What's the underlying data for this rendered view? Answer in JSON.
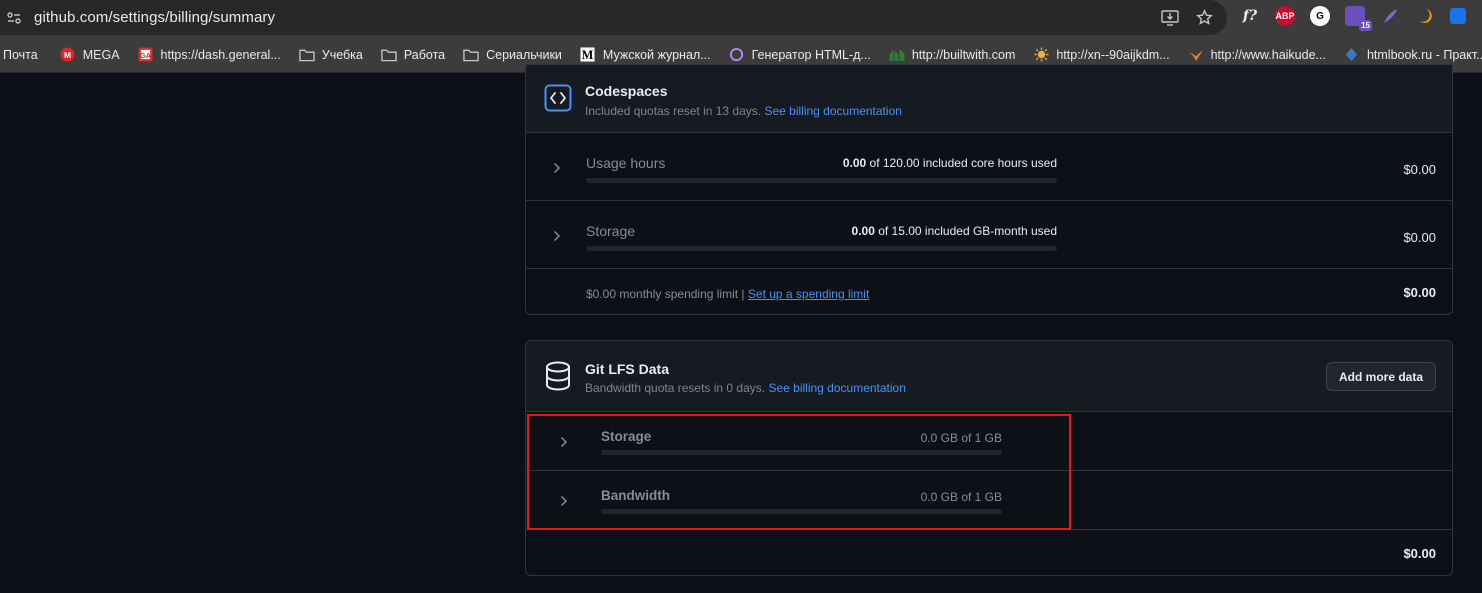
{
  "browser": {
    "url": "github.com/settings/billing/summary",
    "extensions": [
      {
        "name": "f?",
        "color": "#3c3c3c"
      },
      {
        "name": "ABP",
        "color": "#c70d2c"
      },
      {
        "name": "G",
        "color": "#ffffff"
      },
      {
        "name": "",
        "color": "#6b4fbb",
        "badge": "15"
      },
      {
        "name": "",
        "color": "#8a63d2"
      },
      {
        "name": "",
        "color": "#f29900"
      },
      {
        "name": "",
        "color": "#1a73e8"
      }
    ]
  },
  "bookmarks": [
    {
      "label": "Почта",
      "icon": "none"
    },
    {
      "label": "MEGA",
      "icon": "mega-icon"
    },
    {
      "label": "https://dash.general...",
      "icon": "ga-icon"
    },
    {
      "label": "Учебка",
      "icon": "folder-icon"
    },
    {
      "label": "Работа",
      "icon": "folder-icon"
    },
    {
      "label": "Сериальчики",
      "icon": "folder-icon"
    },
    {
      "label": "Мужской журнал...",
      "icon": "m-icon"
    },
    {
      "label": "Генератор HTML-д...",
      "icon": "circle-icon"
    },
    {
      "label": "http://builtwith.com",
      "icon": "builtwith-icon"
    },
    {
      "label": "http://xn--90aijkdm...",
      "icon": "sun-icon"
    },
    {
      "label": "http://www.haikude...",
      "icon": "bird-icon"
    },
    {
      "label": "htmlbook.ru - Практ...",
      "icon": "htmlbook-icon"
    }
  ],
  "codespaces": {
    "title": "Codespaces",
    "subtitle": "Included quotas reset in 13 days.",
    "doc_link": "See billing documentation",
    "rows": [
      {
        "label": "Usage hours",
        "used": "0.00",
        "of_text": "of 120.00 included core hours used",
        "progress": 0,
        "amount": "$0.00"
      },
      {
        "label": "Storage",
        "used": "0.00",
        "of_text": "of 15.00 included GB-month used",
        "progress": 0,
        "amount": "$0.00"
      }
    ],
    "limit_text": "$0.00 monthly spending limit |",
    "limit_link": "Set up a spending limit",
    "total": "$0.00"
  },
  "git_lfs": {
    "title": "Git LFS Data",
    "subtitle": "Bandwidth quota resets in 0 days.",
    "doc_link": "See billing documentation",
    "add_button": "Add more data",
    "rows": [
      {
        "label": "Storage",
        "usage": "0.0 GB of 1 GB",
        "progress": 0
      },
      {
        "label": "Bandwidth",
        "usage": "0.0 GB of 1 GB",
        "progress": 0
      }
    ],
    "total": "$0.00"
  },
  "colors": {
    "accent": "#4493f8",
    "highlight": "#e81616",
    "background": "#0d1117"
  }
}
